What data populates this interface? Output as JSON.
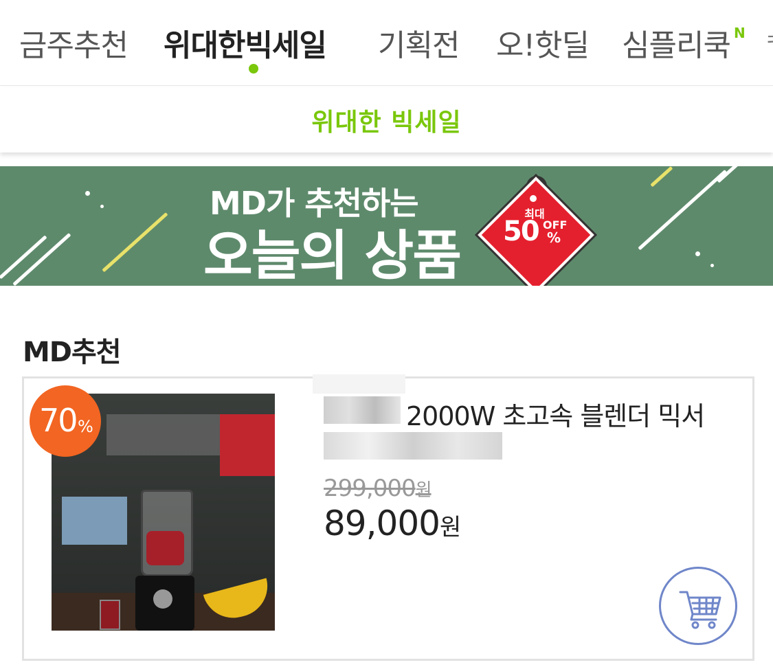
{
  "tabs": [
    {
      "label": "금주추천",
      "active": false
    },
    {
      "label": "위대한빅세일",
      "active": true
    },
    {
      "label": "기획전",
      "active": false
    },
    {
      "label": "오!핫딜",
      "active": false
    },
    {
      "label": "심플리쿡",
      "active": false,
      "badge": "N"
    }
  ],
  "tab_overflow": "ㅋ",
  "subheader": {
    "title": "위대한 빅세일"
  },
  "banner": {
    "subtitle": "MD가 추천하는",
    "title": "오늘의 상품",
    "tag_top": "최대",
    "tag_value": "50",
    "tag_off": "OFF",
    "tag_pct": "%"
  },
  "section": {
    "title": "MD추천"
  },
  "product": {
    "discount_value": "70",
    "discount_unit": "%",
    "name": "2000W 초고속 블렌더 믹서",
    "original_price": "299,000",
    "original_unit": "원",
    "sale_price": "89,000",
    "sale_unit": "원",
    "cart_icon": "cart-icon"
  },
  "colors": {
    "accent": "#7ac70c",
    "banner_bg": "#5e8a6c",
    "discount": "#f26522",
    "cart_border": "#6f86c9"
  }
}
